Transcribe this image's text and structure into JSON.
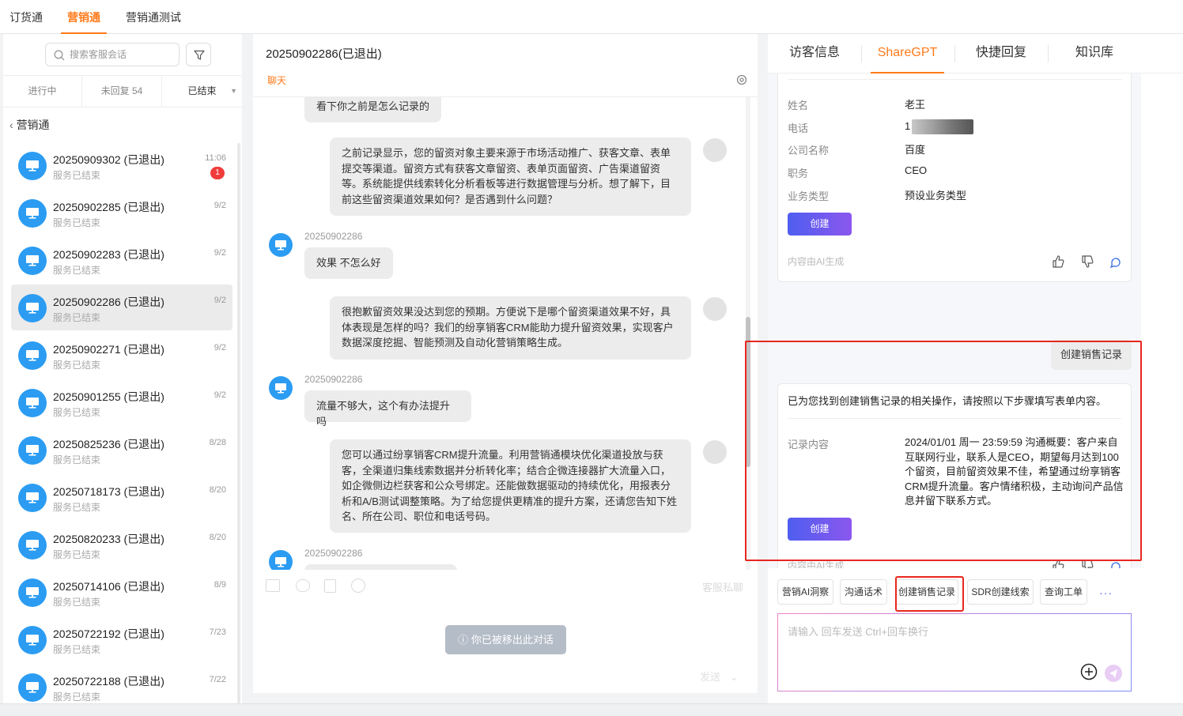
{
  "top_tabs": [
    "订货通",
    "营销通",
    "营销通测试"
  ],
  "left": {
    "search_placeholder": "搜索客服会话",
    "subtabs": [
      "进行中",
      "未回复 54",
      "已结束"
    ],
    "back_label": "营销通",
    "sessions": [
      {
        "name": "20250909302 (已退出)",
        "status": "服务已结束",
        "time": "11:06",
        "badge": "1"
      },
      {
        "name": "20250902285 (已退出)",
        "status": "服务已结束",
        "time": "9/2"
      },
      {
        "name": "20250902283 (已退出)",
        "status": "服务已结束",
        "time": "9/2"
      },
      {
        "name": "20250902286 (已退出)",
        "status": "服务已结束",
        "time": "9/2"
      },
      {
        "name": "20250902271 (已退出)",
        "status": "服务已结束",
        "time": "9/2"
      },
      {
        "name": "20250901255 (已退出)",
        "status": "服务已结束",
        "time": "9/2"
      },
      {
        "name": "20250825236 (已退出)",
        "status": "服务已结束",
        "time": "8/28"
      },
      {
        "name": "20250718173 (已退出)",
        "status": "服务已结束",
        "time": "8/20"
      },
      {
        "name": "20250820233 (已退出)",
        "status": "服务已结束",
        "time": "8/20"
      },
      {
        "name": "20250714106 (已退出)",
        "status": "服务已结束",
        "time": "8/9"
      },
      {
        "name": "20250722192 (已退出)",
        "status": "服务已结束",
        "time": "7/23"
      },
      {
        "name": "20250722188 (已退出)",
        "status": "服务已结束",
        "time": "7/22"
      }
    ]
  },
  "middle": {
    "title": "20250902286(已退出)",
    "subtitle": "聊天",
    "messages": {
      "m0": "看下你之前是怎么记录的",
      "m1": "之前记录显示，您的留资对象主要来源于市场活动推广、获客文章、表单提交等渠道。留资方式有获客文章留资、表单页面留资、广告渠道留资等。系统能提供线索转化分析看板等进行数据管理与分析。想了解下，目前这些留资渠道效果如何？是否遇到什么问题？",
      "s2": "20250902286",
      "m2": "效果 不怎么好",
      "m3": "很抱歉留资效果没达到您的预期。方便说下是哪个留资渠道效果不好，具体表现是怎样的吗？我们的纷享销客CRM能助力提升留资效果，实现客户数据深度挖掘、智能预测及自动化营销策略生成。",
      "s4": "20250902286",
      "m4": "流量不够大，这个有办法提升吗",
      "m5": "您可以通过纷享销客CRM提升流量。利用营销通模块优化渠道投放与获客，全渠道归集线索数据并分析转化率；结合企微连接器扩大流量入口，如企微侧边栏获客和公众号绑定。还能做数据驱动的持续优化，用报表分析和A/B测试调整策略。为了给您提供更精准的提升方案，还请您告知下姓名、所在公司、职位和电话号码。",
      "s6": "20250902286"
    },
    "private_chat": "客服私聊",
    "kicked_notice": "你已被移出此对话",
    "send_label": "发送"
  },
  "right": {
    "tabs": [
      "访客信息",
      "ShareGPT",
      "快捷回复",
      "知识库"
    ],
    "card1": {
      "fields": [
        {
          "label": "姓名",
          "value": "老王"
        },
        {
          "label": "电话",
          "value": "1"
        },
        {
          "label": "公司名称",
          "value": "百度"
        },
        {
          "label": "职务",
          "value": "CEO"
        },
        {
          "label": "业务类型",
          "value": "预设业务类型"
        }
      ],
      "create_label": "创建",
      "ai_note": "内容由AI生成"
    },
    "user_message": "创建销售记录",
    "card2": {
      "intro": "已为您找到创建销售记录的相关操作，请按照以下步骤填写表单内容。",
      "field_label": "记录内容",
      "field_value": "2024/01/01 周一 23:59:59 沟通概要：客户来自互联网行业，联系人是CEO，期望每月达到100个留资，目前留资效果不佳，希望通过纷享销客CRM提升流量。客户情绪积极，主动询问产品信息并留下联系方式。",
      "create_label": "创建",
      "ai_note": "内容由AI生成"
    },
    "quick_actions": [
      "营销AI洞察",
      "沟通话术",
      "创建销售记录",
      "SDR创建线索",
      "查询工单"
    ],
    "more": "···",
    "input_placeholder": "请输入 回车发送 Ctrl+回车换行"
  },
  "colors": {
    "accent": "#ff7a1a",
    "avatar": "#2b9cf2",
    "button_gradient_start": "#4f5ef0",
    "button_gradient_end": "#8b57ee",
    "highlight": "#e8271f",
    "badge": "#f03c3c"
  }
}
